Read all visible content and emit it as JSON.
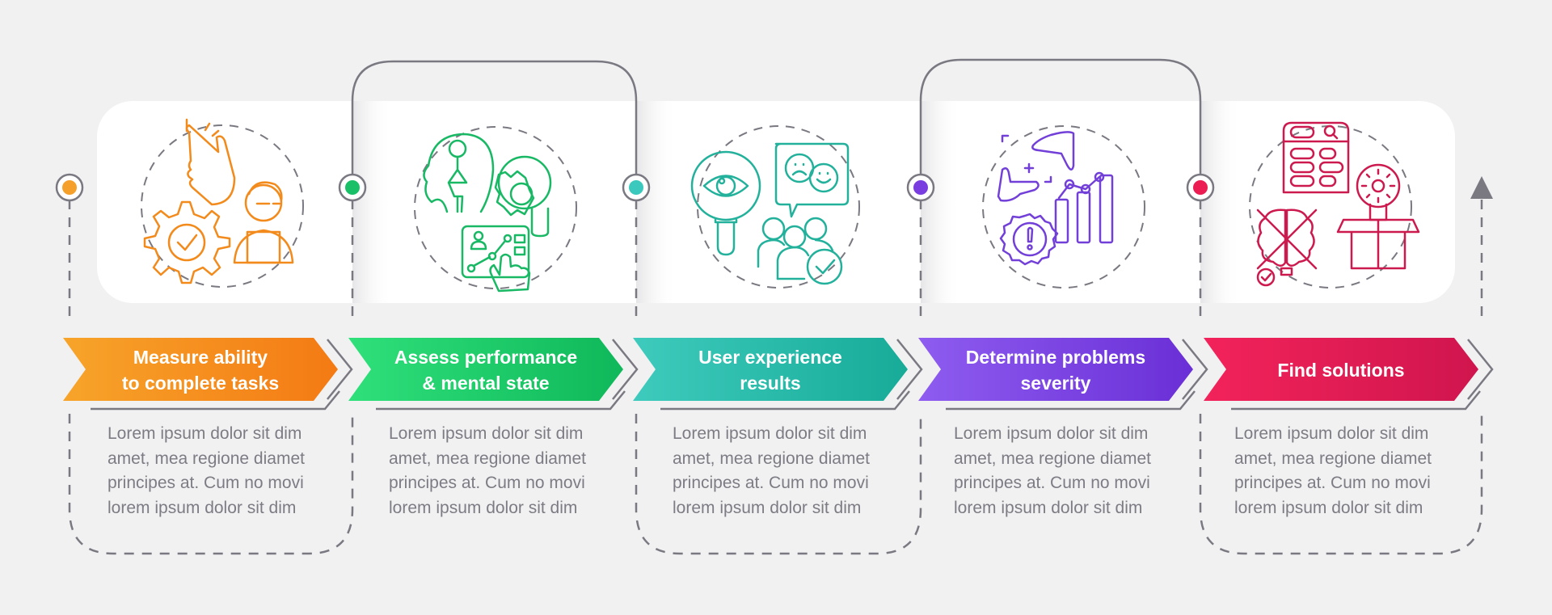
{
  "infographic": {
    "steps": [
      {
        "title_line1": "Measure ability",
        "title_line2": "to complete tasks",
        "color_start": "#f7a42a",
        "color_end": "#f47a14",
        "dot_color": "#f5a02a",
        "icon": "hand-gear-user-icon",
        "description": [
          "Lorem ipsum dolor sit dim",
          "amet, mea regione diamet",
          "principes at. Cum no movi",
          "lorem ipsum dolor sit dim"
        ]
      },
      {
        "title_line1": "Assess performance",
        "title_line2": "& mental state",
        "color_start": "#2fe07a",
        "color_end": "#0fb85a",
        "dot_color": "#19c068",
        "icon": "mind-gear-dashboard-icon",
        "description": [
          "Lorem ipsum dolor sit dim",
          "amet, mea regione diamet",
          "principes at. Cum no movi",
          "lorem ipsum dolor sit dim"
        ]
      },
      {
        "title_line1": "User experience",
        "title_line2": "results",
        "color_start": "#3ecbbd",
        "color_end": "#17ab98",
        "dot_color": "#3ac9bc",
        "icon": "eye-feedback-group-icon",
        "description": [
          "Lorem ipsum dolor sit dim",
          "amet, mea regione diamet",
          "principes at. Cum no movi",
          "lorem ipsum dolor sit dim"
        ]
      },
      {
        "title_line1": "Determine problems",
        "title_line2": "severity",
        "color_start": "#8e5cf0",
        "color_end": "#6a2fd6",
        "dot_color": "#7a3ee0",
        "icon": "frame-warning-chart-icon",
        "description": [
          "Lorem ipsum dolor sit dim",
          "amet, mea regione diamet",
          "principes at. Cum no movi",
          "lorem ipsum dolor sit dim"
        ]
      },
      {
        "title_line1": "Find solutions",
        "title_line2": "",
        "color_start": "#f2235a",
        "color_end": "#d0154e",
        "dot_color": "#ec1d52",
        "icon": "brain-idea-box-icon",
        "description": [
          "Lorem ipsum dolor sit dim",
          "amet, mea regione diamet",
          "principes at. Cum no movi",
          "lorem ipsum dolor sit dim"
        ]
      }
    ],
    "line_color": "#7a7982"
  }
}
